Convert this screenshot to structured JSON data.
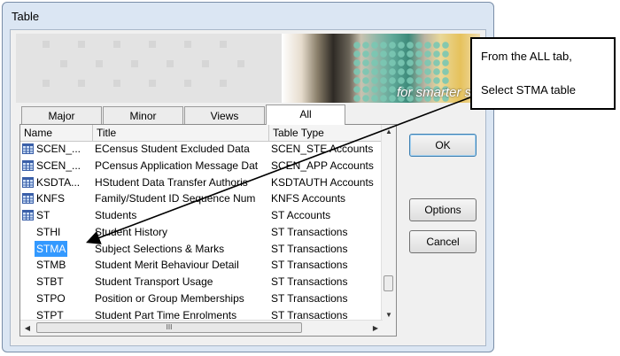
{
  "window": {
    "title": "Table"
  },
  "banner": {
    "tagline": "for smarter schoo"
  },
  "tabs": [
    {
      "label": "Major",
      "active": false
    },
    {
      "label": "Minor",
      "active": false
    },
    {
      "label": "Views",
      "active": false
    },
    {
      "label": "All",
      "active": true
    }
  ],
  "list": {
    "columns": [
      "Name",
      "Title",
      "Table Type"
    ],
    "rows": [
      {
        "name": "SCEN_...",
        "title": "ECensus Student Excluded Data",
        "type": "SCEN_STE Accounts",
        "icon": "table-icon"
      },
      {
        "name": "SCEN_...",
        "title": "PCensus Application Message Dat",
        "type": "SCEN_APP Accounts",
        "icon": "table-icon"
      },
      {
        "name": "KSDTA...",
        "title": "HStudent Data Transfer Authoris",
        "type": "KSDTAUTH Accounts",
        "icon": "table-icon"
      },
      {
        "name": "KNFS",
        "title": "Family/Student ID Sequence Num",
        "type": "KNFS Accounts",
        "icon": "table-icon"
      },
      {
        "name": "ST",
        "title": "Students",
        "type": "ST Accounts",
        "icon": "table-icon"
      },
      {
        "name": "STHI",
        "title": "Student History",
        "type": "ST Transactions",
        "icon": ""
      },
      {
        "name": "STMA",
        "title": "Subject Selections & Marks",
        "type": "ST Transactions",
        "icon": "",
        "selected": true
      },
      {
        "name": "STMB",
        "title": "Student Merit Behaviour Detail",
        "type": "ST Transactions",
        "icon": ""
      },
      {
        "name": "STBT",
        "title": "Student Transport Usage",
        "type": "ST Transactions",
        "icon": ""
      },
      {
        "name": "STPO",
        "title": "Position or Group Memberships",
        "type": "ST Transactions",
        "icon": ""
      },
      {
        "name": "STPT",
        "title": "Student Part Time Enrolments",
        "type": "ST Transactions",
        "icon": "",
        "partial": true
      }
    ]
  },
  "buttons": {
    "ok": "OK",
    "options": "Options",
    "cancel": "Cancel"
  },
  "scroll_thumb_grip": "III",
  "callout": {
    "line1": "From the ALL tab,",
    "line2": "Select STMA table"
  },
  "colors": {
    "selection": "#3399ff",
    "table_icon": "#3a5fa8"
  }
}
